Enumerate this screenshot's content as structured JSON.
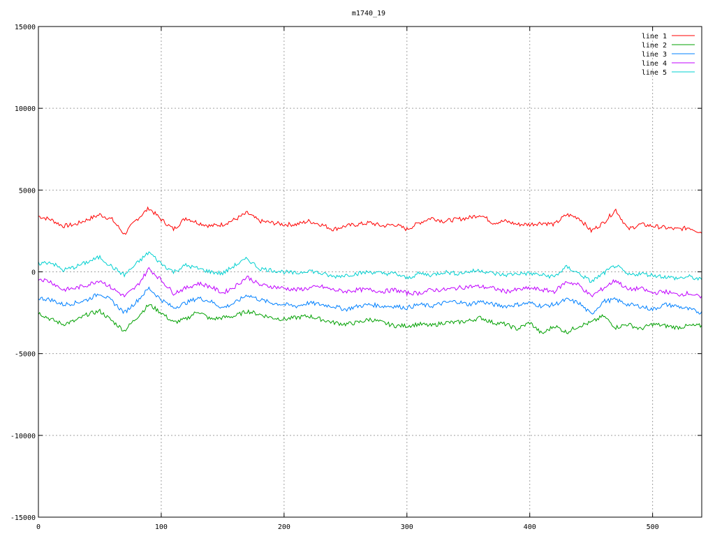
{
  "chart_data": {
    "type": "line",
    "title": "m1740_19",
    "xlabel": "",
    "ylabel": "",
    "xlim": [
      0,
      540
    ],
    "ylim": [
      -15000,
      15000
    ],
    "xticks": [
      0,
      100,
      200,
      300,
      400,
      500
    ],
    "yticks": [
      -15000,
      -10000,
      -5000,
      0,
      5000,
      10000,
      15000
    ],
    "grid": true,
    "legend_position": "top-right",
    "x": [
      0,
      10,
      20,
      30,
      40,
      50,
      60,
      70,
      80,
      90,
      100,
      110,
      120,
      130,
      140,
      150,
      160,
      170,
      180,
      190,
      200,
      210,
      220,
      230,
      240,
      250,
      260,
      270,
      280,
      290,
      300,
      310,
      320,
      330,
      340,
      350,
      360,
      370,
      380,
      390,
      400,
      410,
      420,
      430,
      440,
      450,
      460,
      470,
      480,
      490,
      500,
      510,
      520,
      530,
      540
    ],
    "series": [
      {
        "name": "line 1",
        "color": "#ff0000",
        "values": [
          3400,
          3200,
          2800,
          2900,
          3200,
          3500,
          3200,
          2300,
          3200,
          3900,
          3200,
          2600,
          3300,
          3000,
          2800,
          2900,
          3200,
          3600,
          3100,
          3000,
          2900,
          2900,
          3100,
          2900,
          2600,
          2800,
          2900,
          3000,
          2800,
          2900,
          2600,
          3000,
          3300,
          3100,
          3200,
          3300,
          3500,
          3000,
          3100,
          2900,
          2900,
          3000,
          2900,
          3500,
          3300,
          2500,
          3000,
          3800,
          2600,
          2900,
          2800,
          2700,
          2600,
          2700,
          2400
        ]
      },
      {
        "name": "line 2",
        "color": "#00a000",
        "values": [
          -2500,
          -2900,
          -3200,
          -3000,
          -2600,
          -2400,
          -3000,
          -3600,
          -2800,
          -2000,
          -2500,
          -3100,
          -2900,
          -2400,
          -2900,
          -2800,
          -2700,
          -2400,
          -2600,
          -2800,
          -2900,
          -2800,
          -2700,
          -2900,
          -3100,
          -3200,
          -3100,
          -2900,
          -3100,
          -3300,
          -3300,
          -3200,
          -3300,
          -3100,
          -3100,
          -3000,
          -2800,
          -3100,
          -3200,
          -3500,
          -3100,
          -3800,
          -3300,
          -3700,
          -3300,
          -3100,
          -2700,
          -3400,
          -3200,
          -3500,
          -3200,
          -3300,
          -3400,
          -3300,
          -3300
        ]
      },
      {
        "name": "line 3",
        "color": "#0080ff",
        "values": [
          -1600,
          -1700,
          -2000,
          -1900,
          -1700,
          -1300,
          -1800,
          -2500,
          -1800,
          -1000,
          -1700,
          -2200,
          -1900,
          -1600,
          -1800,
          -2200,
          -1900,
          -1400,
          -1700,
          -1900,
          -2000,
          -2100,
          -1900,
          -2000,
          -2100,
          -2300,
          -2100,
          -2000,
          -2100,
          -2100,
          -2200,
          -2000,
          -2100,
          -1900,
          -1800,
          -2000,
          -1800,
          -2000,
          -2100,
          -2000,
          -1900,
          -2100,
          -2000,
          -1700,
          -1900,
          -2600,
          -1800,
          -1700,
          -2000,
          -2100,
          -2300,
          -2000,
          -2100,
          -2300,
          -2500
        ]
      },
      {
        "name": "line 4",
        "color": "#c000ff",
        "values": [
          -400,
          -600,
          -1100,
          -1000,
          -800,
          -500,
          -1000,
          -1500,
          -900,
          200,
          -500,
          -1300,
          -1000,
          -700,
          -900,
          -1300,
          -900,
          -300,
          -800,
          -900,
          -1000,
          -1100,
          -1000,
          -900,
          -1100,
          -1200,
          -1100,
          -1100,
          -1200,
          -1100,
          -1300,
          -1300,
          -1100,
          -1100,
          -1000,
          -900,
          -900,
          -1000,
          -1200,
          -1100,
          -1000,
          -1100,
          -1200,
          -600,
          -800,
          -1500,
          -1000,
          -500,
          -1100,
          -1000,
          -1300,
          -1200,
          -1400,
          -1300,
          -1600
        ]
      },
      {
        "name": "line 5",
        "color": "#00d0d0",
        "values": [
          500,
          600,
          100,
          300,
          600,
          900,
          300,
          -200,
          500,
          1200,
          500,
          0,
          400,
          200,
          0,
          -100,
          400,
          800,
          200,
          100,
          0,
          -100,
          100,
          -100,
          -300,
          -200,
          -100,
          0,
          -100,
          -100,
          -400,
          -100,
          -200,
          0,
          -100,
          0,
          100,
          -100,
          -200,
          -100,
          -100,
          -200,
          -300,
          300,
          -100,
          -600,
          -100,
          400,
          -200,
          -100,
          -200,
          -300,
          -400,
          -300,
          -500
        ]
      }
    ]
  }
}
